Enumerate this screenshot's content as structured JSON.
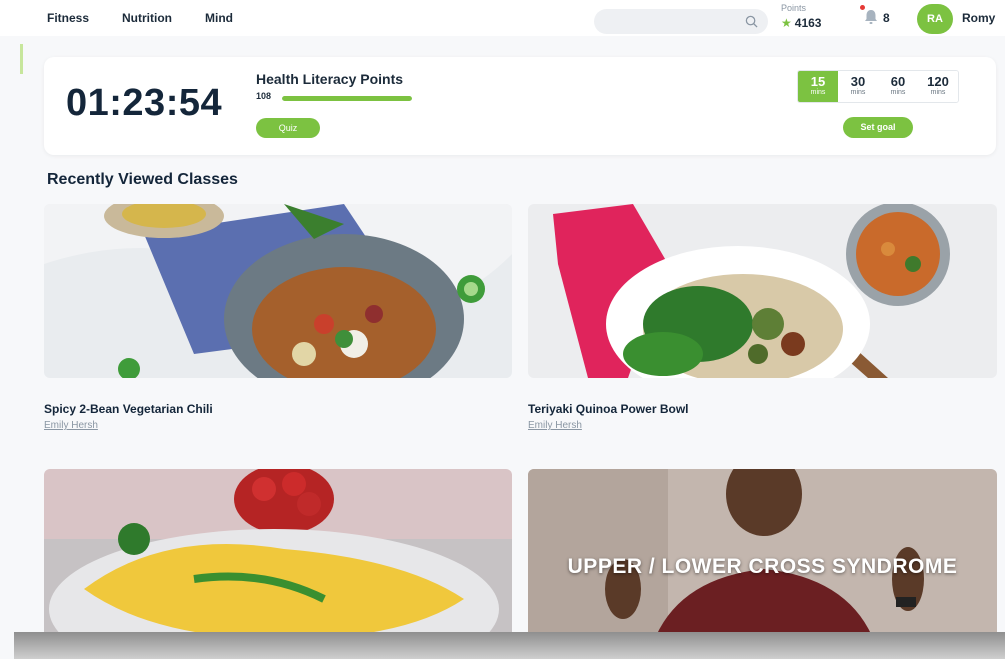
{
  "nav": {
    "items": [
      "Fitness",
      "Nutrition",
      "Mind"
    ],
    "search_placeholder": "",
    "points_label": "Points",
    "points_value": "4163",
    "notification_count": "8",
    "avatar_initials": "RA",
    "username": "Romy"
  },
  "goal": {
    "timer": "01:23:54",
    "hlp_title": "Health Literacy Points",
    "hlp_value": "108",
    "hlp_progress_percent": 100,
    "quiz_label": "Quiz",
    "durations": [
      {
        "value": "15",
        "unit": "mins",
        "active": true
      },
      {
        "value": "30",
        "unit": "mins",
        "active": false
      },
      {
        "value": "60",
        "unit": "mins",
        "active": false
      },
      {
        "value": "120",
        "unit": "mins",
        "active": false
      }
    ],
    "set_goal_label": "Set goal"
  },
  "recent": {
    "title": "Recently Viewed Classes",
    "classes": [
      {
        "title": "Spicy 2-Bean Vegetarian Chili",
        "author": "Emily Hersh"
      },
      {
        "title": "Teriyaki Quinoa Power Bowl",
        "author": "Emily Hersh"
      },
      {
        "title": "",
        "author": ""
      },
      {
        "title": "",
        "author": "",
        "overlay": "UPPER / LOWER CROSS SYNDROME"
      }
    ]
  },
  "colors": {
    "accent": "#7cc241",
    "text": "#14263a",
    "muted": "#8a96a3",
    "notification_dot": "#e53935"
  }
}
